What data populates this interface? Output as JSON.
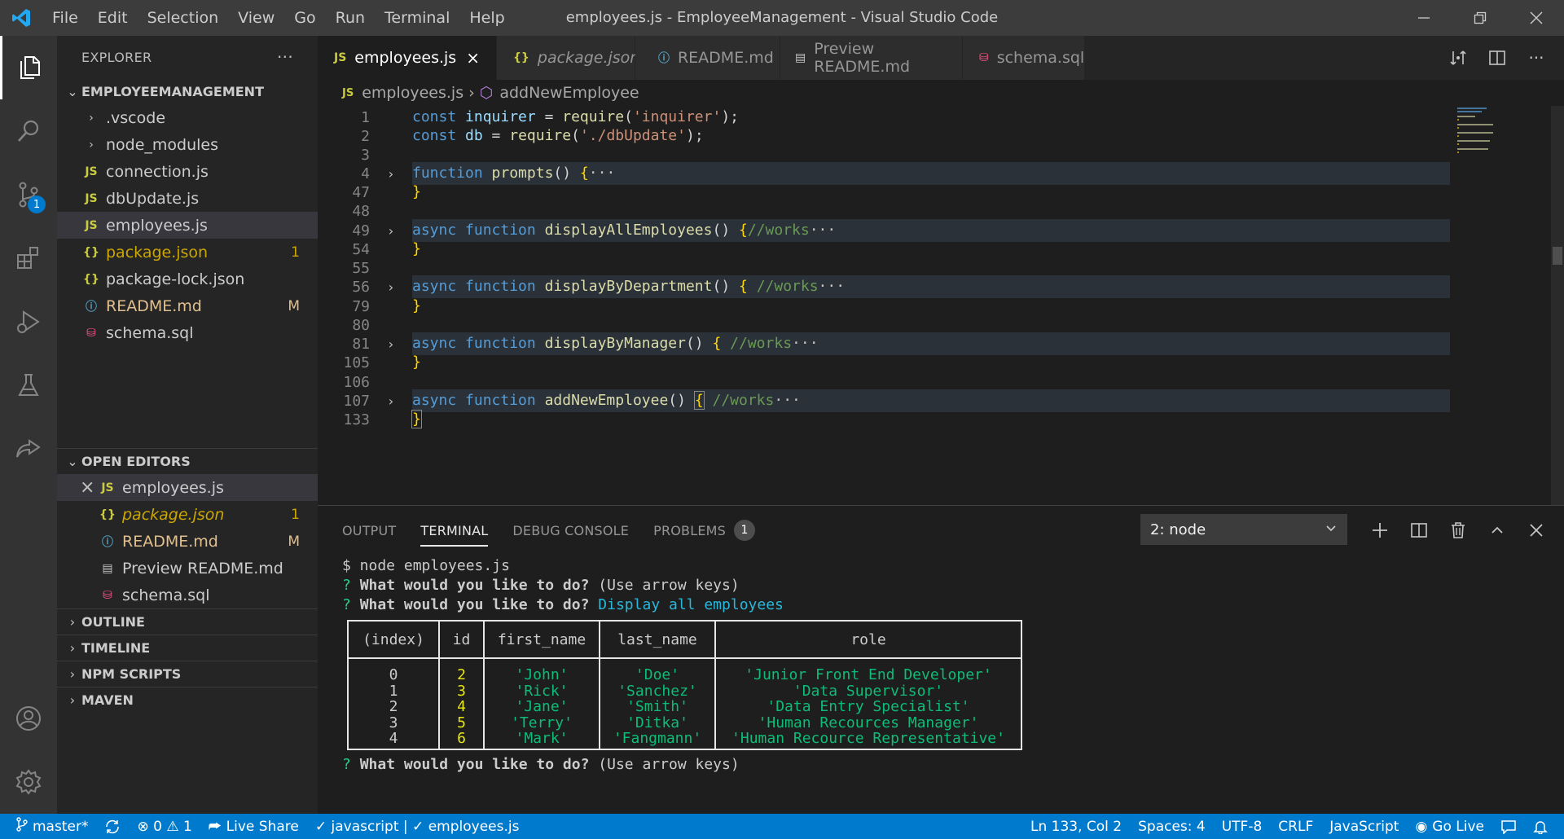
{
  "titlebar": {
    "menu": [
      "File",
      "Edit",
      "Selection",
      "View",
      "Go",
      "Run",
      "Terminal",
      "Help"
    ],
    "title": "employees.js - EmployeeManagement - Visual Studio Code",
    "logo_icon": "vscode-logo-icon",
    "accent": "#007acc"
  },
  "activitybar": {
    "items": [
      "explorer-icon",
      "search-icon",
      "source-control-icon",
      "extensions-icon",
      "run-debug-icon",
      "testing-icon",
      "live-share-icon"
    ],
    "source_control_badge": "1",
    "bottom": [
      "accounts-icon",
      "settings-gear-icon"
    ]
  },
  "sidebar": {
    "header": "EXPLORER",
    "more": "···",
    "project": "EMPLOYEEMANAGEMENT",
    "files": [
      {
        "name": ".vscode",
        "kind": "folder"
      },
      {
        "name": "node_modules",
        "kind": "folder"
      },
      {
        "name": "connection.js",
        "kind": "js"
      },
      {
        "name": "dbUpdate.js",
        "kind": "js"
      },
      {
        "name": "employees.js",
        "kind": "js"
      },
      {
        "name": "package.json",
        "kind": "json",
        "deco": "1"
      },
      {
        "name": "package-lock.json",
        "kind": "json"
      },
      {
        "name": "README.md",
        "kind": "info",
        "deco": "M"
      },
      {
        "name": "schema.sql",
        "kind": "db"
      }
    ],
    "open_editors_title": "OPEN EDITORS",
    "open_editors": [
      {
        "name": "employees.js",
        "kind": "js",
        "close": "×"
      },
      {
        "name": "package.json",
        "kind": "json",
        "deco": "1"
      },
      {
        "name": "README.md",
        "kind": "info",
        "deco": "M"
      },
      {
        "name": "Preview README.md",
        "kind": "preview"
      },
      {
        "name": "schema.sql",
        "kind": "db"
      }
    ],
    "sections": [
      "OUTLINE",
      "TIMELINE",
      "NPM SCRIPTS",
      "MAVEN"
    ]
  },
  "tabs": [
    {
      "label": "employees.js",
      "icon": "JS",
      "active": true,
      "close": "×"
    },
    {
      "label": "package.json",
      "icon": "{}",
      "italic": true
    },
    {
      "label": "README.md",
      "icon": "ⓘ"
    },
    {
      "label": "Preview README.md",
      "icon": "▤"
    },
    {
      "label": "schema.sql",
      "icon": "⛁"
    }
  ],
  "breadcrumb": {
    "file": "employees.js",
    "symbol": "addNewEmployee"
  },
  "code": {
    "line_numbers": [
      "1",
      "2",
      "3",
      "4",
      "47",
      "48",
      "49",
      "54",
      "55",
      "56",
      "79",
      "80",
      "81",
      "105",
      "106",
      "107",
      "133"
    ],
    "line1": {
      "kw": "const",
      "var": "inquirer",
      "op": " = ",
      "fn": "require",
      "open": "(",
      "str": "'inquirer'",
      "close": ");"
    },
    "line2": {
      "kw": "const",
      "var": "db",
      "op": " = ",
      "fn": "require",
      "open": "(",
      "str": "'./dbUpdate'",
      "close": ");"
    },
    "line4": {
      "kw": "function",
      "fn": "prompts",
      "sig": "() ",
      "brace": "{",
      "ell": "···"
    },
    "line49": {
      "kw1": "async",
      "kw2": "function",
      "fn": "displayAllEmployees",
      "sig": "() ",
      "brace": "{",
      "cm": "//works",
      "ell": "···"
    },
    "line56": {
      "kw1": "async",
      "kw2": "function",
      "fn": "displayByDepartment",
      "sig": "() ",
      "brace": "{",
      "cm": "//works",
      "ell": "···"
    },
    "line81": {
      "kw1": "async",
      "kw2": "function",
      "fn": "displayByManager",
      "sig": "() ",
      "brace": "{",
      "cm": "//works",
      "ell": "···"
    },
    "line107": {
      "kw1": "async",
      "kw2": "function",
      "fn": "addNewEmployee",
      "sig": "() ",
      "brace": "{",
      "cm": "//works",
      "ell": "···"
    },
    "close_brace": "}"
  },
  "panel": {
    "tabs": [
      "OUTPUT",
      "TERMINAL",
      "DEBUG CONSOLE",
      "PROBLEMS"
    ],
    "problems_count": "1",
    "terminal_select": "2: node",
    "actions": [
      "plus-icon",
      "split-icon",
      "trash-icon",
      "chevron-up-icon",
      "close-icon"
    ]
  },
  "terminal": {
    "cmd": "$ node employees.js",
    "q1_mark": "?",
    "q1_text": "What would you like to do?",
    "q1_hint": "(Use arrow keys)",
    "q2_mark": "?",
    "q2_text": "What would you like to do?",
    "q2_answer": "Display all employees",
    "table_headers": [
      "(index)",
      "id",
      "first_name",
      "last_name",
      "role"
    ],
    "table_rows": [
      [
        "0",
        "2",
        "'John'",
        "'Doe'",
        "'Junior Front End Developer'"
      ],
      [
        "1",
        "3",
        "'Rick'",
        "'Sanchez'",
        "'Data Supervisor'"
      ],
      [
        "2",
        "4",
        "'Jane'",
        "'Smith'",
        "'Data Entry Specialist'"
      ],
      [
        "3",
        "5",
        "'Terry'",
        "'Ditka'",
        "'Human Recources Manager'"
      ],
      [
        "4",
        "6",
        "'Mark'",
        "'Fangmann'",
        "'Human Recource Representative'"
      ]
    ],
    "q3_mark": "?",
    "q3_text": "What would you like to do?",
    "q3_hint": "(Use arrow keys)"
  },
  "statusbar": {
    "branch": "master*",
    "errors": "0",
    "warnings": "1",
    "live_share": "Live Share",
    "check1": "javascript",
    "check2": "employees.js",
    "position": "Ln 133, Col 2",
    "spaces": "Spaces: 4",
    "encoding": "UTF-8",
    "eol": "CRLF",
    "language": "JavaScript",
    "golive": "Go Live"
  }
}
